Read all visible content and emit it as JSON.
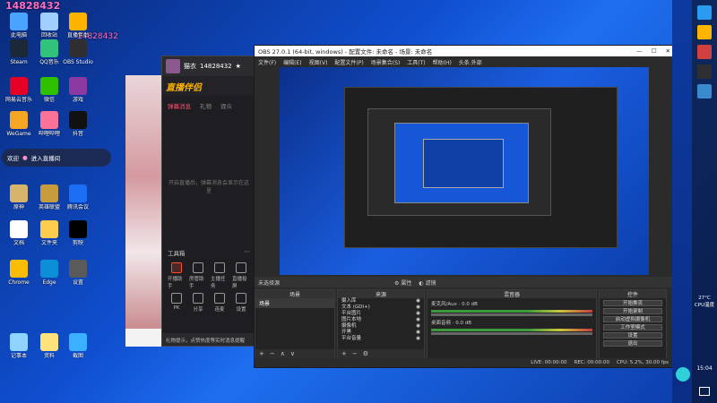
{
  "overlay": {
    "line1": "14828432",
    "line2": "14828432"
  },
  "live_banner": {
    "left": "欢迎",
    "right": "进入直播间"
  },
  "desktop_icons": [
    {
      "label": "此电脑",
      "color": "#4aa3ff"
    },
    {
      "label": "回收站",
      "color": "#9fd0ff"
    },
    {
      "label": "直播伴侣",
      "color": "#ffb400"
    },
    {
      "label": "Steam",
      "color": "#1b2838"
    },
    {
      "label": "QQ音乐",
      "color": "#31c27c"
    },
    {
      "label": "OBS Studio",
      "color": "#302e31"
    },
    {
      "label": "网易云音乐",
      "color": "#e60026"
    },
    {
      "label": "微信",
      "color": "#2dc100"
    },
    {
      "label": "游戏",
      "color": "#8a3aa0"
    },
    {
      "label": "WeGame",
      "color": "#f5a623"
    },
    {
      "label": "哔哩哔哩",
      "color": "#fb7299"
    },
    {
      "label": "抖音",
      "color": "#111111"
    },
    {
      "label": "原神",
      "color": "#d6b46a"
    },
    {
      "label": "英雄联盟",
      "color": "#c89b3c"
    },
    {
      "label": "腾讯会议",
      "color": "#1b6ef3"
    },
    {
      "label": "文档",
      "color": "#ffffff"
    },
    {
      "label": "文件夹",
      "color": "#ffcc4d"
    },
    {
      "label": "剪映",
      "color": "#000000"
    },
    {
      "label": "Chrome",
      "color": "#fbbc04"
    },
    {
      "label": "Edge",
      "color": "#0c8fd6"
    },
    {
      "label": "设置",
      "color": "#5a5a5a"
    },
    {
      "label": "记事本",
      "color": "#8fd3ff"
    },
    {
      "label": "资料",
      "color": "#ffe27a"
    },
    {
      "label": "截图",
      "color": "#3ab0ff"
    }
  ],
  "assistant": {
    "title_name": "猫衣",
    "title_id": "14828432",
    "logo": "直播伴侣",
    "tabs": [
      "弹幕消息",
      "礼物",
      "观众"
    ],
    "placeholder": "开启直播后，弹幕消息会显示在这里",
    "tools_header": "工具箱",
    "tools": [
      "开播助手",
      "房管助手",
      "主播任务",
      "直播投屏",
      "PK",
      "分享",
      "连麦",
      "设置",
      "音乐",
      "PK赛",
      "下载",
      "设置"
    ],
    "footer": "礼物提示，点赞热度等实时消息提醒"
  },
  "obs": {
    "title": "OBS 27.0.1 (64-bit, windows) - 配置文件: 未命名 - 场景: 未命名",
    "menu": [
      "文件(F)",
      "编辑(E)",
      "视图(V)",
      "配置文件(P)",
      "场景集合(S)",
      "工具(T)",
      "帮助(H)",
      "头条.外部"
    ],
    "ctx_left": "未选择源",
    "ctx_mid1": "属性",
    "ctx_mid2": "滤镜",
    "docks": {
      "scenes_title": "场景",
      "scene_item": "场景",
      "sources_title": "来源",
      "sources": [
        "摄入库",
        "文本 (GDI+)",
        "平台图片",
        "图片本地",
        "摄像机",
        "开黑",
        "平台音量"
      ],
      "mixer_title": "混音器",
      "mixer_channels": [
        "麦克风/Aux",
        "桌面音频"
      ],
      "mixer_db": "0.0 dB",
      "transitions_title": "转场",
      "controls_title": "控件",
      "controls": [
        "开始推流",
        "开始录制",
        "启动虚拟摄像机",
        "工作室模式",
        "设置",
        "退出"
      ]
    },
    "status": [
      "LIVE: 00:00:00",
      "REC: 00:00:00",
      "CPU: 5.2%, 30.00 fps"
    ]
  },
  "tray": {
    "temp": "27°C",
    "cpu": "CPU温度",
    "time": "15:04"
  }
}
